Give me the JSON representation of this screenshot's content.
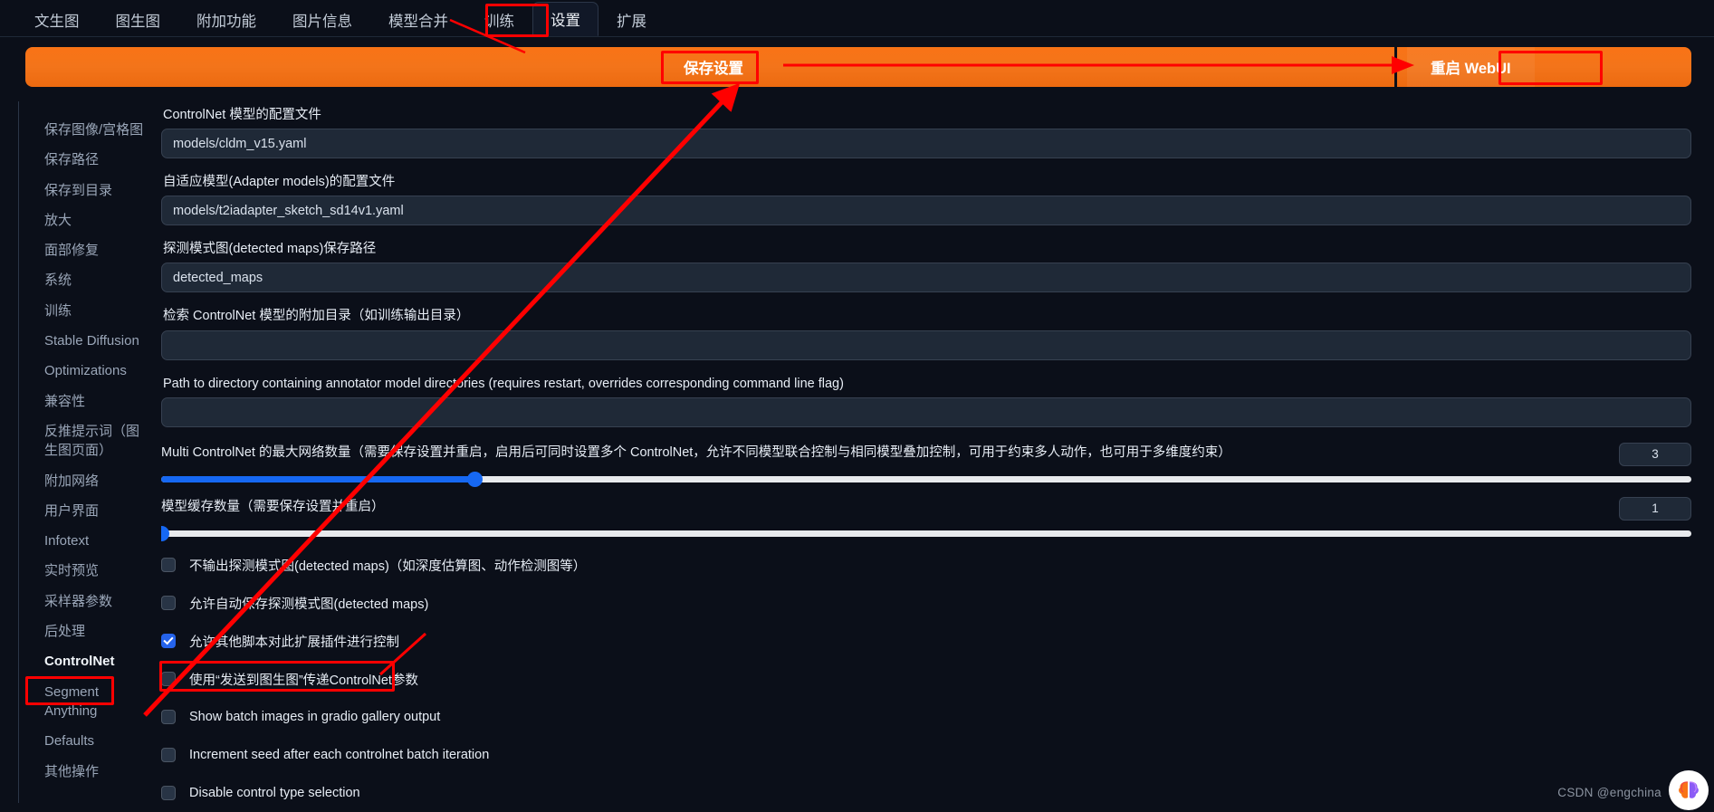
{
  "tabs": [
    {
      "label": "文生图",
      "active": false
    },
    {
      "label": "图生图",
      "active": false
    },
    {
      "label": "附加功能",
      "active": false
    },
    {
      "label": "图片信息",
      "active": false
    },
    {
      "label": "模型合并",
      "active": false
    },
    {
      "label": "训练",
      "active": false
    },
    {
      "label": "设置",
      "active": true
    },
    {
      "label": "扩展",
      "active": false
    }
  ],
  "actionbar": {
    "save_label": "保存设置",
    "restart_label": "重启 WebUI",
    "color": "#f97316"
  },
  "sidebar": {
    "items": [
      {
        "label": "保存图像/宫格图",
        "active": false
      },
      {
        "label": "保存路径",
        "active": false
      },
      {
        "label": "保存到目录",
        "active": false
      },
      {
        "label": "放大",
        "active": false
      },
      {
        "label": "面部修复",
        "active": false
      },
      {
        "label": "系统",
        "active": false
      },
      {
        "label": "训练",
        "active": false
      },
      {
        "label": "Stable Diffusion",
        "active": false
      },
      {
        "label": "Optimizations",
        "active": false
      },
      {
        "label": "兼容性",
        "active": false
      },
      {
        "label": "反推提示词（图生图页面）",
        "active": false
      },
      {
        "label": "附加网络",
        "active": false
      },
      {
        "label": "用户界面",
        "active": false
      },
      {
        "label": "Infotext",
        "active": false
      },
      {
        "label": "实时预览",
        "active": false
      },
      {
        "label": "采样器参数",
        "active": false
      },
      {
        "label": "后处理",
        "active": false
      },
      {
        "label": "ControlNet",
        "active": true
      },
      {
        "label": "Segment Anything",
        "active": false
      },
      {
        "label": "Defaults",
        "active": false
      },
      {
        "label": "其他操作",
        "active": false
      }
    ]
  },
  "main": {
    "textfields": [
      {
        "label": "ControlNet 模型的配置文件",
        "value": "models/cldm_v15.yaml"
      },
      {
        "label": "自适应模型(Adapter models)的配置文件",
        "value": "models/t2iadapter_sketch_sd14v1.yaml"
      },
      {
        "label": "探测模式图(detected maps)保存路径",
        "value": "detected_maps"
      },
      {
        "label": "检索 ControlNet 模型的附加目录（如训练输出目录）",
        "value": ""
      },
      {
        "label": "Path to directory containing annotator model directories (requires restart, overrides corresponding command line flag)",
        "value": ""
      }
    ],
    "sliders": [
      {
        "label": "Multi ControlNet 的最大网络数量（需要保存设置并重启，启用后可同时设置多个 ControlNet，允许不同模型联合控制与相同模型叠加控制，可用于约束多人动作，也可用于多维度约束）",
        "value": "3",
        "percent": 20.5
      },
      {
        "label": "模型缓存数量（需要保存设置并重启）",
        "value": "1",
        "percent": 0
      }
    ],
    "checkboxes": [
      {
        "label": "不输出探测模式图(detected maps)（如深度估算图、动作检测图等）",
        "checked": false
      },
      {
        "label": "允许自动保存探测模式图(detected maps)",
        "checked": false
      },
      {
        "label": "允许其他脚本对此扩展插件进行控制",
        "checked": true
      },
      {
        "label": "使用“发送到图生图”传递ControlNet参数",
        "checked": false
      },
      {
        "label": "Show batch images in gradio gallery output",
        "checked": false
      },
      {
        "label": "Increment seed after each controlnet batch iteration",
        "checked": false
      },
      {
        "label": "Disable control type selection",
        "checked": false
      }
    ]
  },
  "annotations": {
    "color": "#ff0000",
    "highlight_tab": "设置",
    "highlight_save": "保存设置",
    "highlight_restart": "重启 WebUI",
    "highlight_sidebar": "ControlNet",
    "highlight_checkbox": "允许其他脚本对此扩展插件进行控制"
  },
  "watermark": {
    "text": "CSDN @engchina"
  }
}
